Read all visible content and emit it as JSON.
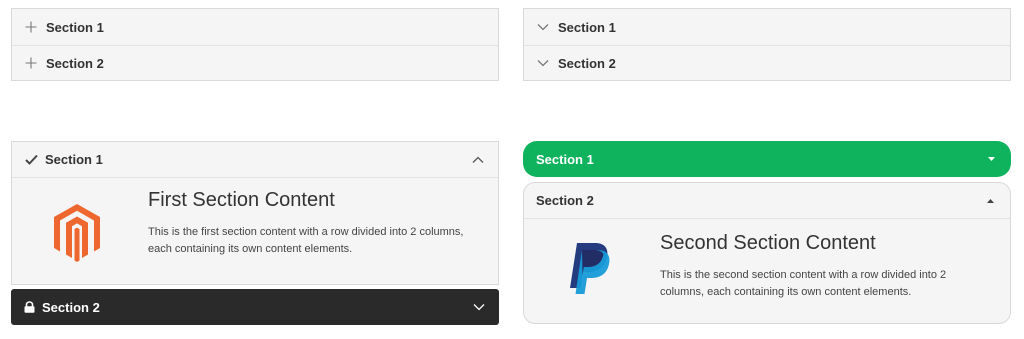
{
  "accordion_plus": {
    "items": [
      {
        "label": "Section 1",
        "icon": "plus-icon"
      },
      {
        "label": "Section 2",
        "icon": "plus-icon"
      }
    ]
  },
  "accordion_chevron": {
    "items": [
      {
        "label": "Section 1",
        "icon": "chevron-down-icon"
      },
      {
        "label": "Section 2",
        "icon": "chevron-down-icon"
      }
    ]
  },
  "accordion_icons": {
    "section1": {
      "label": "Section 1",
      "icon": "checkmark-icon",
      "toggle_icon": "chevron-up-icon",
      "content_title": "First Section Content",
      "content_text": "This is the first section content with a row divided into 2 columns, each containing its own content elements.",
      "logo": "magento-logo"
    },
    "section2": {
      "label": "Section 2",
      "icon": "lock-icon",
      "toggle_icon": "chevron-down-icon"
    },
    "colors": {
      "dark_header": "#2a2a2a"
    }
  },
  "accordion_rounded": {
    "section1": {
      "label": "Section 1",
      "toggle_icon": "caret-down-icon"
    },
    "section2": {
      "label": "Section 2",
      "toggle_icon": "caret-up-icon",
      "content_title": "Second Section Content",
      "content_text": "This is the second section content with a row divided into 2 columns, each containing its own content elements.",
      "logo": "paypal-logo"
    },
    "colors": {
      "active_header": "#0fb35e"
    }
  }
}
